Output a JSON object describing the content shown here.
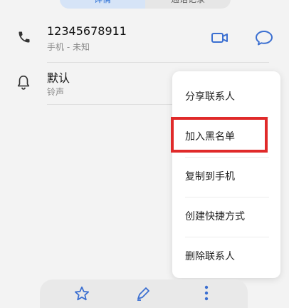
{
  "tabs": [
    {
      "label": "详情"
    },
    {
      "label": "通话记录"
    }
  ],
  "contact": {
    "number": "12345678911",
    "number_type": "手机 - 未知"
  },
  "ringtone": {
    "value": "默认",
    "label": "铃声"
  },
  "menu": {
    "items": [
      {
        "label": "分享联系人"
      },
      {
        "label": "加入黑名单"
      },
      {
        "label": "复制到手机"
      },
      {
        "label": "创建快捷方式"
      },
      {
        "label": "删除联系人"
      }
    ],
    "highlighted_item": "加入黑名单",
    "highlight_color": "#e02a2a"
  },
  "colors": {
    "accent": "#2a6fd6",
    "icon": "#3b6fd1"
  },
  "icons": {
    "phone": "phone-icon",
    "video": "video-call-icon",
    "message": "message-icon",
    "ringtone": "bell-icon",
    "favorite": "star-icon",
    "edit": "pen-icon",
    "more": "more-vertical-icon"
  }
}
